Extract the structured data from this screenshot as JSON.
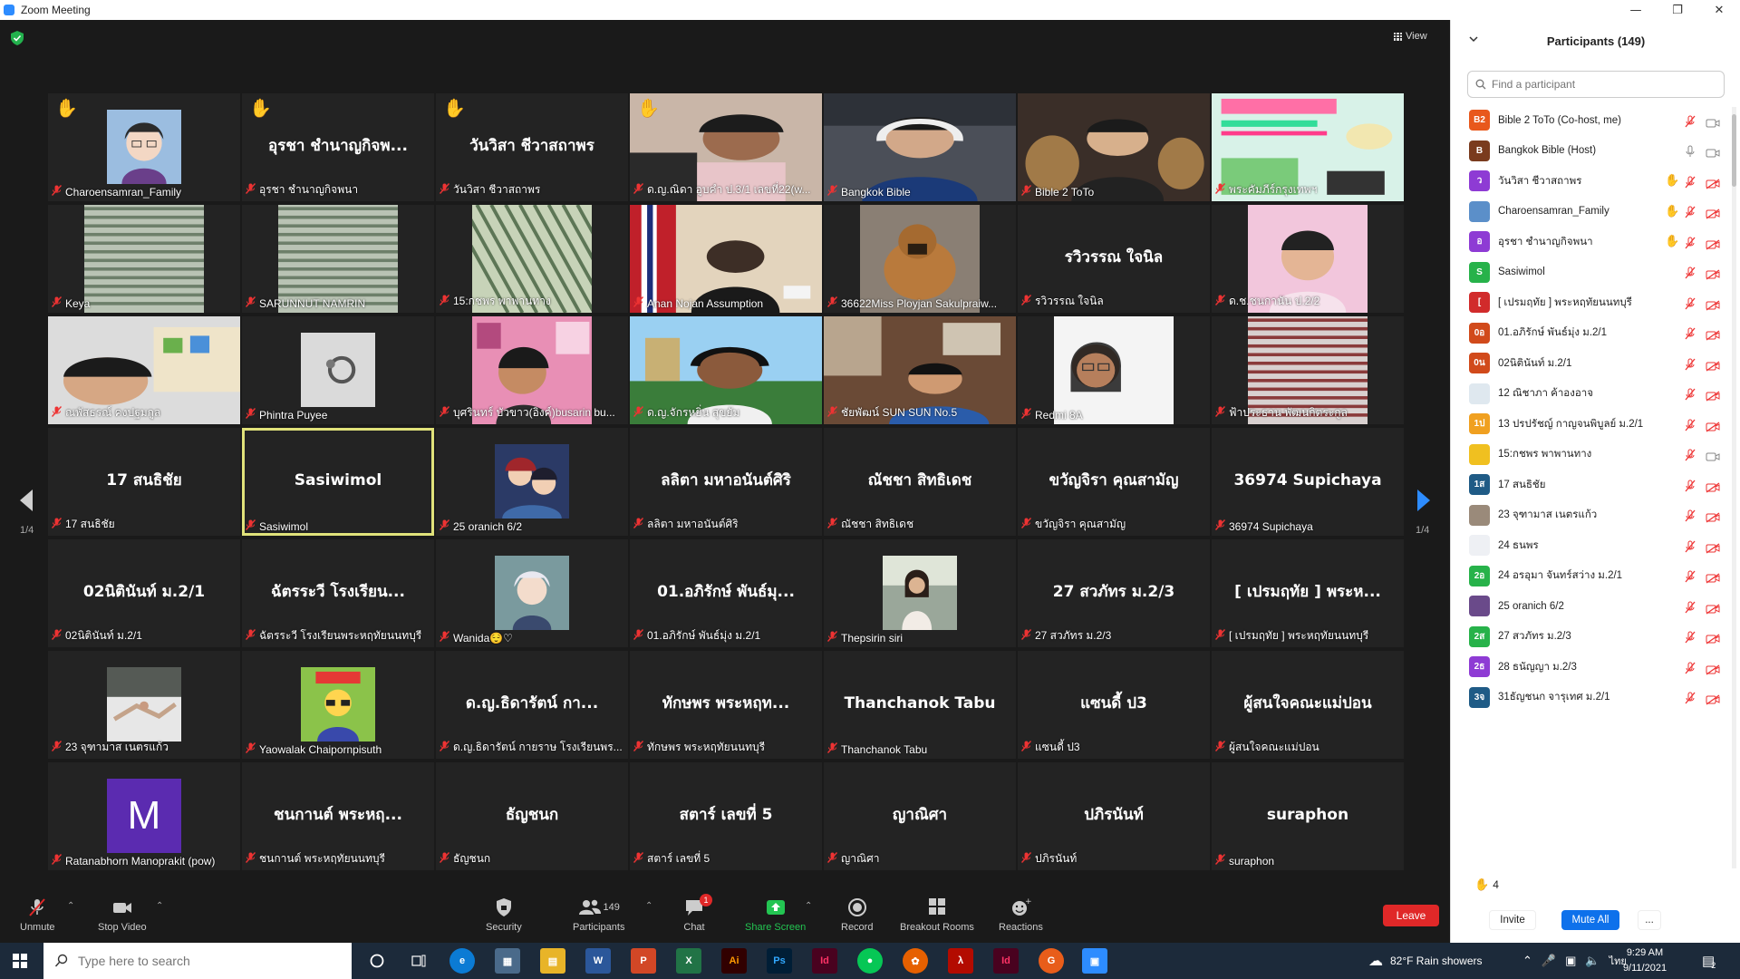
{
  "window": {
    "title": "Zoom Meeting"
  },
  "top_controls": {
    "view_label": "View"
  },
  "pagination": {
    "left": "1/4",
    "right": "1/4"
  },
  "tiles": [
    {
      "name": "Charoensamran_Family",
      "big": "",
      "hand": true,
      "video": "avatar-anime",
      "active": false
    },
    {
      "name": "อุรชา ชำนาญกิจพนา",
      "big": "อุรชา ชำนาญกิจพ...",
      "hand": true,
      "video": "",
      "active": false
    },
    {
      "name": "วันวิสา ชีวาสถาพร",
      "big": "วันวิสา ชีวาสถาพร",
      "hand": true,
      "video": "",
      "active": false
    },
    {
      "name": "ด.ญ.ณิดา อูบคำ ป.3/1 เลขที่22(w...",
      "big": "",
      "hand": true,
      "video": "girl-room",
      "active": false
    },
    {
      "name": "Bangkok Bible",
      "big": "",
      "hand": false,
      "video": "man-headset",
      "active": false
    },
    {
      "name": "Bible 2 ToTo",
      "big": "",
      "hand": false,
      "video": "man-statues",
      "active": false
    },
    {
      "name": "พระคัมภีร์กรุงเทพฯ",
      "big": "",
      "hand": false,
      "video": "poster",
      "active": false
    },
    {
      "name": "Keya",
      "big": "",
      "hand": false,
      "video": "window-blind",
      "active": false
    },
    {
      "name": "SARUNNUT NAMRIN",
      "big": "",
      "hand": false,
      "video": "window-blind",
      "active": false
    },
    {
      "name": "15:กชพร พาพานทาง",
      "big": "",
      "hand": false,
      "video": "blinds-green",
      "active": false
    },
    {
      "name": "Anan Nojan Assumption",
      "big": "",
      "hand": false,
      "video": "flag-room",
      "active": false
    },
    {
      "name": "36622Miss Ployjan Sakulpraiw...",
      "big": "",
      "hand": false,
      "video": "dog",
      "active": false
    },
    {
      "name": "รวิวรรณ ใจนิล",
      "big": "รวิวรรณ ใจนิล",
      "hand": false,
      "video": "",
      "active": false
    },
    {
      "name": "ด.ช.ชนกานัน ป.2/2",
      "big": "",
      "hand": false,
      "video": "kid-pink",
      "active": false
    },
    {
      "name": "ณพัสธรณ์ คงปฐมกูล",
      "big": "",
      "hand": false,
      "video": "boy-shelf",
      "active": false
    },
    {
      "name": "Phintra Puyee",
      "big": "",
      "hand": false,
      "video": "ring",
      "active": false
    },
    {
      "name": "บุศรินทร์ บัวขาว(อิงค์)busarin bu...",
      "big": "",
      "hand": false,
      "video": "girl-posters",
      "active": false
    },
    {
      "name": "ด.ญ.จักรหยิ่น สุขยัม",
      "big": "",
      "hand": false,
      "video": "girl-headphones",
      "active": false
    },
    {
      "name": "ชัยพัฒน์ SUN SUN No.5",
      "big": "",
      "hand": false,
      "video": "boy-desk",
      "active": false
    },
    {
      "name": "Redmi 8A",
      "big": "",
      "hand": false,
      "video": "girl-glasses",
      "active": false
    },
    {
      "name": "ฟ้าประธาน พัฒนกิตระกูล",
      "big": "",
      "hand": false,
      "video": "window-blind-red",
      "active": false
    },
    {
      "name": "17 สนธิชัย",
      "big": "17 สนธิชัย",
      "hand": false,
      "video": "",
      "active": false
    },
    {
      "name": "Sasiwimol",
      "big": "Sasiwimol",
      "hand": false,
      "video": "",
      "active": true
    },
    {
      "name": "25 oranich 6/2",
      "big": "",
      "hand": false,
      "video": "anime-duo",
      "active": false
    },
    {
      "name": "ลลิตา มหาอนันต์ศิริ",
      "big": "ลลิตา มหาอนันต์ศิริ",
      "hand": false,
      "video": "",
      "active": false
    },
    {
      "name": "ณัชชา สิทธิเดช",
      "big": "ณัชชา สิทธิเดช",
      "hand": false,
      "video": "",
      "active": false
    },
    {
      "name": "ขวัญจิรา คุณสามัญ",
      "big": "ขวัญจิรา คุณสามัญ",
      "hand": false,
      "video": "",
      "active": false
    },
    {
      "name": "36974 Supichaya",
      "big": "36974 Supichaya",
      "hand": false,
      "video": "",
      "active": false
    },
    {
      "name": "02นิตินันท์ ม.2/1",
      "big": "02นิตินันท์ ม.2/1",
      "hand": false,
      "video": "",
      "active": false
    },
    {
      "name": "ฉัตรระวี โรงเรียนพระหฤทัยนนทบุรี",
      "big": "ฉัตรระวี โรงเรียน...",
      "hand": false,
      "video": "",
      "active": false
    },
    {
      "name": "Wanida😌♡",
      "big": "",
      "hand": false,
      "video": "anime-boy",
      "active": false
    },
    {
      "name": "01.อภิรักษ์ พันธ์มุ่ง ม.2/1",
      "big": "01.อภิรักษ์ พันธ์มุ...",
      "hand": false,
      "video": "",
      "active": false
    },
    {
      "name": "Thepsirin siri",
      "big": "",
      "hand": false,
      "video": "woman-photo",
      "active": false
    },
    {
      "name": "27 สวภัทร  ม.2/3",
      "big": "27 สวภัทร  ม.2/3",
      "hand": false,
      "video": "",
      "active": false
    },
    {
      "name": "[ เปรมฤทัย ] พระหฤทัยนนทบุรี",
      "big": "[ เปรมฤทัย ] พระห...",
      "hand": false,
      "video": "",
      "active": false
    },
    {
      "name": "23 จุฑามาส เนตรแก้ว",
      "big": "",
      "hand": false,
      "video": "snow-person",
      "active": false
    },
    {
      "name": "Yaowalak Chaipornpisuth",
      "big": "",
      "hand": false,
      "video": "cartoon-hat",
      "active": false
    },
    {
      "name": "ด.ญ.ธิดารัตน์ กายราษ โรงเรียนพร...",
      "big": "ด.ญ.ธิดารัตน์ กา...",
      "hand": false,
      "video": "",
      "active": false
    },
    {
      "name": "ทักษพร พระหฤทัยนนทบุรี",
      "big": "ทักษพร พระหฤท...",
      "hand": false,
      "video": "",
      "active": false
    },
    {
      "name": "Thanchanok Tabu",
      "big": "Thanchanok Tabu",
      "hand": false,
      "video": "",
      "active": false
    },
    {
      "name": "แซนดี้ ป3",
      "big": "แซนดี้ ป3",
      "hand": false,
      "video": "",
      "active": false
    },
    {
      "name": "ผู้สนใจคณะแม่ปอน",
      "big": "ผู้สนใจคณะแม่ปอน",
      "hand": false,
      "video": "",
      "active": false
    },
    {
      "name": "Ratanabhorn Manoprakit (pow)",
      "big": "",
      "hand": false,
      "video": "letter-m",
      "active": false
    },
    {
      "name": "ชนกานต์ พระหฤทัยนนทบุรี",
      "big": "ชนกานต์ พระหฤ...",
      "hand": false,
      "video": "",
      "active": false
    },
    {
      "name": "ธัญชนก",
      "big": "ธัญชนก",
      "hand": false,
      "video": "",
      "active": false
    },
    {
      "name": "สตาร์ เลขที่ 5",
      "big": "สตาร์ เลขที่ 5",
      "hand": false,
      "video": "",
      "active": false
    },
    {
      "name": "ญาณิศา",
      "big": "ญาณิศา",
      "hand": false,
      "video": "",
      "active": false
    },
    {
      "name": "ปภิรนันท์",
      "big": "ปภิรนันท์",
      "hand": false,
      "video": "",
      "active": false
    },
    {
      "name": "suraphon",
      "big": "suraphon",
      "hand": false,
      "video": "",
      "active": false
    }
  ],
  "toolbar": {
    "unmute": "Unmute",
    "stop_video": "Stop Video",
    "security": "Security",
    "participants": "Participants",
    "participants_count": "149",
    "chat": "Chat",
    "chat_badge": "1",
    "share_screen": "Share Screen",
    "record": "Record",
    "breakout": "Breakout Rooms",
    "reactions": "Reactions",
    "leave": "Leave"
  },
  "panel": {
    "title": "Participants (149)",
    "search_placeholder": "Find a participant",
    "raised_count": "4",
    "invite": "Invite",
    "mute_all": "Mute All",
    "more": "...",
    "participants": [
      {
        "initials": "B2",
        "color": "#e8581c",
        "name": "Bible 2 ToTo (Co-host, me)",
        "hand": false,
        "mic": "muted",
        "cam": "on"
      },
      {
        "initials": "B",
        "color": "#7a3b1e",
        "name": "Bangkok Bible (Host)",
        "hand": false,
        "mic": "on",
        "cam": "on"
      },
      {
        "initials": "ว",
        "color": "#8e3bd4",
        "name": "วันวิสา ชีวาสถาพร",
        "hand": true,
        "mic": "muted",
        "cam": "off"
      },
      {
        "initials": "",
        "color": "#5b8fc9",
        "name": "Charoensamran_Family",
        "hand": true,
        "mic": "muted",
        "cam": "off"
      },
      {
        "initials": "อ",
        "color": "#8e3bd4",
        "name": "อุรชา ชำนาญกิจพนา",
        "hand": true,
        "mic": "muted",
        "cam": "off"
      },
      {
        "initials": "S",
        "color": "#27b24a",
        "name": "Sasiwimol",
        "hand": false,
        "mic": "muted",
        "cam": "off"
      },
      {
        "initials": "[",
        "color": "#d12b2b",
        "name": "[ เปรมฤทัย ] พระหฤทัยนนทบุรี",
        "hand": false,
        "mic": "muted",
        "cam": "off"
      },
      {
        "initials": "0อ",
        "color": "#d14a1b",
        "name": "01.อภิรักษ์ พันธ์มุ่ง ม.2/1",
        "hand": false,
        "mic": "muted",
        "cam": "off"
      },
      {
        "initials": "0น",
        "color": "#d14a1b",
        "name": "02นิตินันท์ ม.2/1",
        "hand": false,
        "mic": "muted",
        "cam": "off"
      },
      {
        "initials": "",
        "color": "#dfe8ef",
        "name": "12 ณิชาภา ค้าองอาจ",
        "hand": false,
        "mic": "muted",
        "cam": "off"
      },
      {
        "initials": "1ป",
        "color": "#f0a020",
        "name": "13 ปรปรัชญ์ กาญจนพิบูลย์ ม.2/1",
        "hand": false,
        "mic": "muted",
        "cam": "off"
      },
      {
        "initials": "",
        "color": "#f0c020",
        "name": "15:กชพร พาพานทาง",
        "hand": false,
        "mic": "muted",
        "cam": "on"
      },
      {
        "initials": "1ส",
        "color": "#1f5b86",
        "name": "17 สนธิชัย",
        "hand": false,
        "mic": "muted",
        "cam": "off"
      },
      {
        "initials": "",
        "color": "#9a8a7a",
        "name": "23 จุฑามาส เนตรแก้ว",
        "hand": false,
        "mic": "muted",
        "cam": "off"
      },
      {
        "initials": "",
        "color": "#eef0f4",
        "name": "24 ธนพร",
        "hand": false,
        "mic": "muted",
        "cam": "off"
      },
      {
        "initials": "2อ",
        "color": "#27b24a",
        "name": "24 อรอุมา จันทร์สว่าง ม.2/1",
        "hand": false,
        "mic": "muted",
        "cam": "off"
      },
      {
        "initials": "",
        "color": "#6a4a8a",
        "name": "25 oranich 6/2",
        "hand": false,
        "mic": "muted",
        "cam": "off"
      },
      {
        "initials": "2ส",
        "color": "#27b24a",
        "name": "27 สวภัทร  ม.2/3",
        "hand": false,
        "mic": "muted",
        "cam": "off"
      },
      {
        "initials": "2ธ",
        "color": "#8e3bd4",
        "name": "28 ธนัญญา ม.2/3",
        "hand": false,
        "mic": "muted",
        "cam": "off"
      },
      {
        "initials": "3จ",
        "color": "#1f5b86",
        "name": "31ธัญชนก   จารุเทศ ม.2/1",
        "hand": false,
        "mic": "muted",
        "cam": "off"
      }
    ]
  },
  "taskbar": {
    "search_placeholder": "Type here to search",
    "weather": "82°F  Rain showers",
    "lang": "ไทย",
    "time": "9:29 AM",
    "date": "9/11/2021",
    "notif_count": "2"
  }
}
